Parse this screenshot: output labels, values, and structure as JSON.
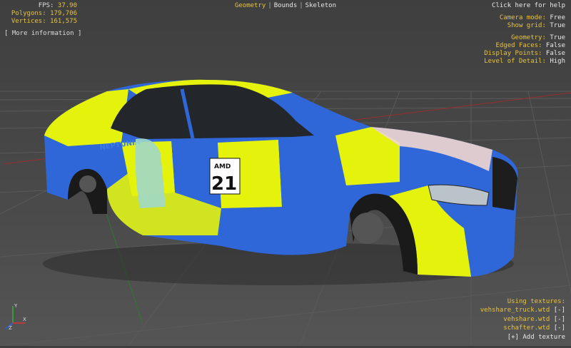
{
  "stats": {
    "fps_label": "FPS:",
    "fps_value": "37.90",
    "polygons_label": "Polygons:",
    "polygons_value": "179,706",
    "vertices_label": "Vertices:",
    "vertices_value": "161,575",
    "more_info": "[ More information ]"
  },
  "tabs": {
    "geometry": "Geometry",
    "bounds": "Bounds",
    "skeleton": "Skeleton",
    "separator": "|"
  },
  "help_link": "Click here for help",
  "settings": [
    {
      "label": "Camera mode:",
      "value": "Free"
    },
    {
      "label": "Show grid:",
      "value": "True"
    },
    {
      "label": "Geometry:",
      "value": "True"
    },
    {
      "label": "Edged Faces:",
      "value": "False"
    },
    {
      "label": "Display Points:",
      "value": "False"
    },
    {
      "label": "Level of Detail:",
      "value": "High"
    }
  ],
  "textures": {
    "header": "Using textures:",
    "items": [
      {
        "name": "vehshare_truck.wtd",
        "toggle": "[-]"
      },
      {
        "name": "vehshare.wtd",
        "toggle": "[-]"
      },
      {
        "name": "schafter.wtd",
        "toggle": "[-]"
      }
    ],
    "add": "[+] Add texture"
  },
  "car_livery": {
    "sponsor": "AMD",
    "number": "21",
    "door_text": "NEPTUNIA",
    "colors": {
      "body_blue": "#2f67d8",
      "body_yellow": "#e4f20c",
      "glass": "#23262b"
    }
  },
  "axes": {
    "x": "X",
    "y": "Y",
    "z": "Z"
  }
}
